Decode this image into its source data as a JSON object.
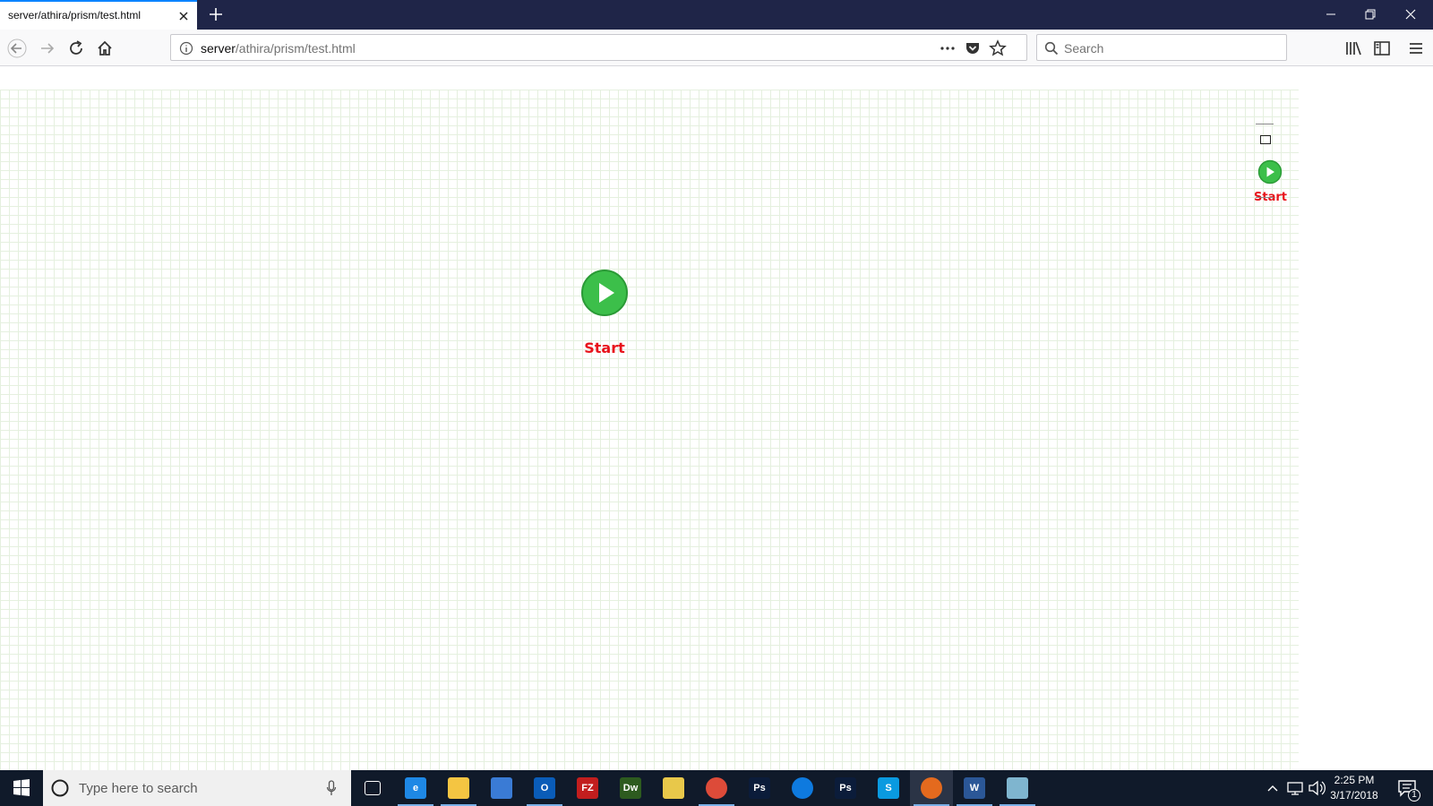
{
  "browser": {
    "tab_title": "server/athira/prism/test.html",
    "url_host": "server",
    "url_path": "/athira/prism/test.html",
    "search_placeholder": "Search"
  },
  "canvas": {
    "start_node_label": "Start",
    "palette_start_label": "Start"
  },
  "taskbar": {
    "search_placeholder": "Type here to search",
    "apps": [
      {
        "name": "task-view",
        "color": "#101a2a",
        "text": ""
      },
      {
        "name": "edge",
        "color": "#1e88e5",
        "text": "e"
      },
      {
        "name": "file-explorer",
        "color": "#f4c542",
        "text": ""
      },
      {
        "name": "store",
        "color": "#3a7bd5",
        "text": ""
      },
      {
        "name": "outlook",
        "color": "#0a5cb8",
        "text": "O"
      },
      {
        "name": "filezilla",
        "color": "#c21e1e",
        "text": "FZ"
      },
      {
        "name": "dreamweaver",
        "color": "#2d5b1f",
        "text": "Dw"
      },
      {
        "name": "notes",
        "color": "#e8c84a",
        "text": ""
      },
      {
        "name": "chrome",
        "color": "#dd4b39",
        "text": ""
      },
      {
        "name": "photoshop-dark",
        "color": "#0b1c3a",
        "text": "Ps"
      },
      {
        "name": "teamviewer",
        "color": "#0e7adf",
        "text": ""
      },
      {
        "name": "photoshop",
        "color": "#0b1c3a",
        "text": "Ps"
      },
      {
        "name": "skype",
        "color": "#0a9ae0",
        "text": "S"
      },
      {
        "name": "firefox",
        "color": "#e46a1e",
        "text": ""
      },
      {
        "name": "word",
        "color": "#2b5797",
        "text": "W"
      },
      {
        "name": "app-generic",
        "color": "#7fb5cf",
        "text": ""
      }
    ],
    "time": "2:25 PM",
    "date": "3/17/2018",
    "notification_count": "1"
  }
}
